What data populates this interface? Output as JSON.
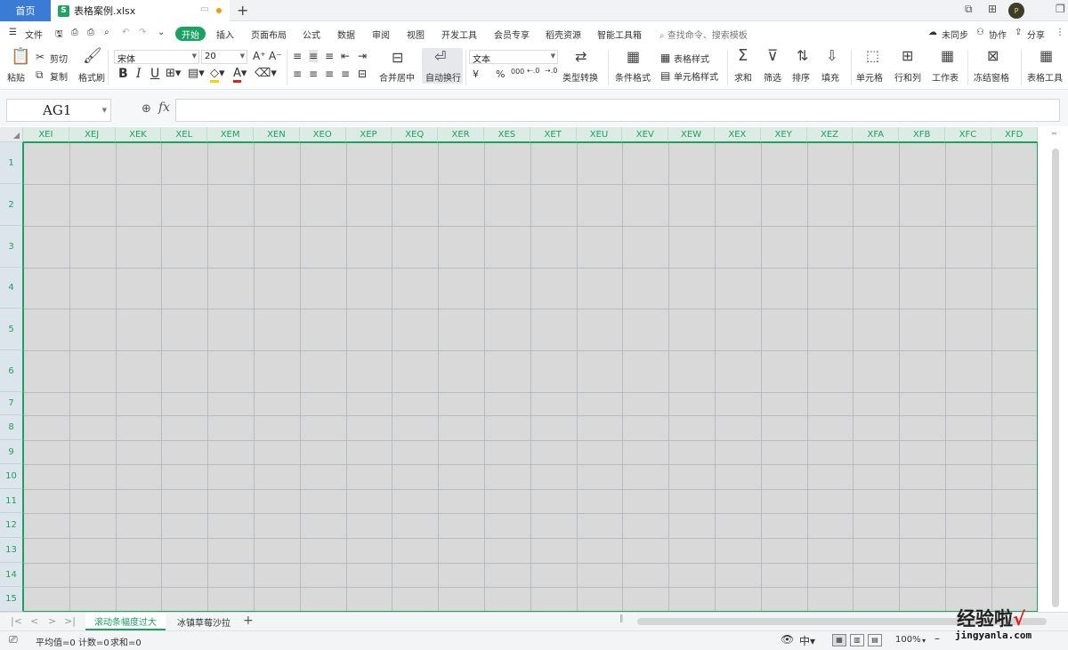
{
  "titlebar": {
    "home_tab": "首页",
    "file_name": "表格案例.xlsx",
    "file_icon": "S",
    "new_tab": "+",
    "avatar_text": "P"
  },
  "menu": {
    "file": "文件",
    "start": "开始",
    "items": [
      "插入",
      "页面布局",
      "公式",
      "数据",
      "审阅",
      "视图",
      "开发工具",
      "会员专享",
      "稻壳资源",
      "智能工具箱"
    ],
    "search_placeholder": "查找命令、搜索模板",
    "unsynced": "未同步",
    "collab": "协作",
    "share": "分享"
  },
  "ribbon": {
    "paste": "粘贴",
    "cut": "剪切",
    "copy": "复制",
    "format_painter": "格式刷",
    "font_name": "宋体",
    "font_size": "20",
    "bold": "B",
    "italic": "I",
    "underline": "U",
    "merge_center": "合并居中",
    "wrap_text": "自动换行",
    "number_format": "文本",
    "currency": "¥",
    "percent": "%",
    "thousands": "000",
    "type_convert": "类型转换",
    "cond_format": "条件格式",
    "table_style": "表格样式",
    "cell_style": "单元格样式",
    "sum": "求和",
    "filter": "筛选",
    "sort": "排序",
    "fill": "填充",
    "cell": "单元格",
    "row_col": "行和列",
    "worksheet": "工作表",
    "freeze": "冻结窗格",
    "table_tools": "表格工具"
  },
  "formula_bar": {
    "name_box": "AG1",
    "fx": "fx",
    "formula": ""
  },
  "grid": {
    "columns": [
      "XEI",
      "XEJ",
      "XEK",
      "XEL",
      "XEM",
      "XEN",
      "XEO",
      "XEP",
      "XEQ",
      "XER",
      "XES",
      "XET",
      "XEU",
      "XEV",
      "XEW",
      "XEX",
      "XEY",
      "XEZ",
      "XFA",
      "XFB",
      "XFC",
      "XFD"
    ],
    "rows": [
      "1",
      "2",
      "3",
      "4",
      "5",
      "6",
      "7",
      "8",
      "9",
      "10",
      "11",
      "12",
      "13",
      "14",
      "15"
    ]
  },
  "sheets": {
    "tabs": [
      "滚动条幅度过大",
      "冰镇草莓沙拉"
    ],
    "active": 0,
    "add": "+"
  },
  "status": {
    "average": "平均值=0",
    "count": "计数=0",
    "sum": "求和=0",
    "zoom": "100%"
  },
  "watermark": {
    "text": "经验啦",
    "check": "√",
    "url": "jingyanla.com"
  },
  "colors": {
    "accent": "#1aa260",
    "home_tab": "#3a7bd5",
    "cell_fill": "#d9d9d9"
  }
}
